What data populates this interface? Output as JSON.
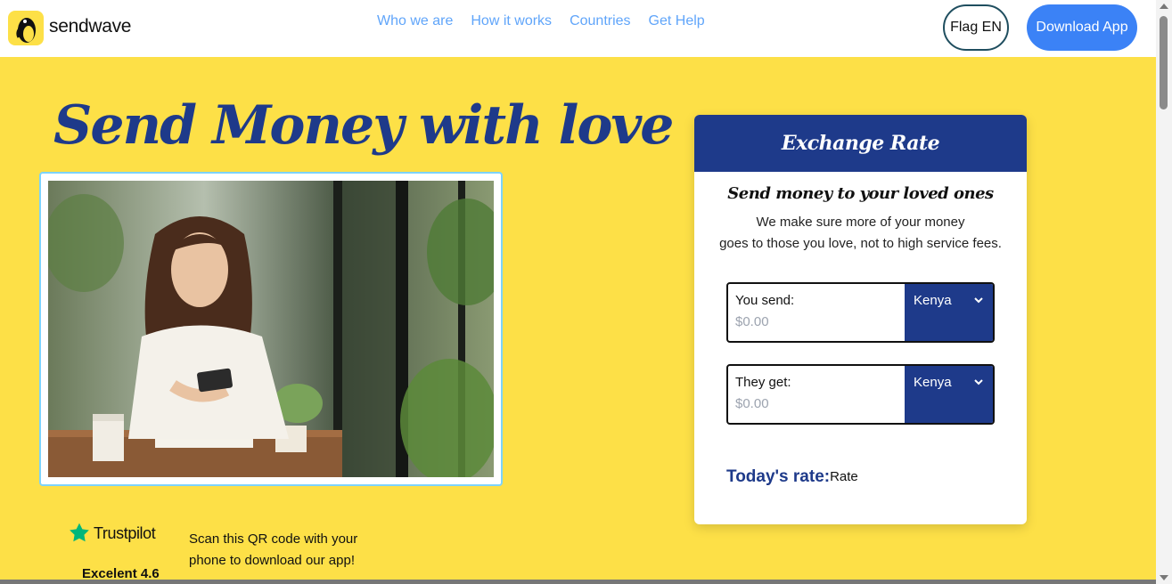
{
  "header": {
    "brand": "sendwave",
    "nav": [
      "Who we are",
      "How it works",
      "Countries",
      "Get Help"
    ],
    "flag_button": "Flag EN",
    "download_button": "Download App"
  },
  "hero": {
    "title": "Send Money with love",
    "photo_icon": "woman-using-phone-photo"
  },
  "trustpilot": {
    "name": "Trustpilot",
    "score": "Excelent 4.6"
  },
  "qr_text": "Scan this QR code with your phone to download our app!",
  "card": {
    "title": "Exchange Rate",
    "subtitle": "Send money to your loved ones",
    "desc_line1": "We make sure more of your money",
    "desc_line2": "goes to those you love, not to high service fees.",
    "send": {
      "label": "You send:",
      "placeholder": "$0.00",
      "country": "Kenya"
    },
    "get": {
      "label": "They get:",
      "placeholder": "$0.00",
      "country": "Kenya"
    },
    "rate_label": "Today's rate:",
    "rate_value": "Rate"
  },
  "colors": {
    "page_bg": "#fde047",
    "navy": "#1e3a8a",
    "nav_link": "#60a5fa",
    "download_btn": "#3b82f6",
    "photo_border": "#7dd3fc",
    "trustpilot_star": "#00b67a"
  }
}
